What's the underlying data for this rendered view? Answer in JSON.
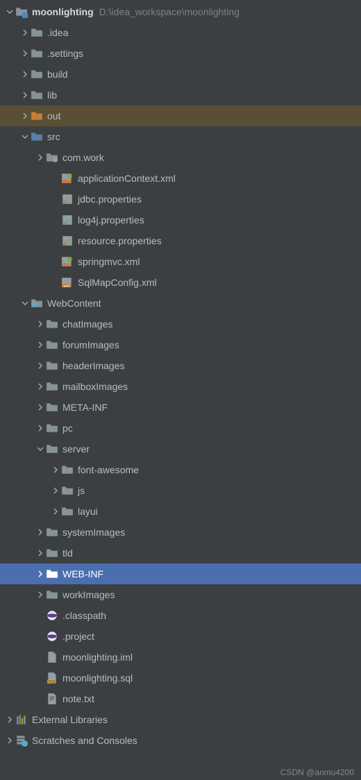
{
  "project": {
    "name": "moonlighting",
    "path": "D:\\idea_workspace\\moonlighting"
  },
  "tree": [
    {
      "id": "root",
      "indent": 0,
      "arrow": "down",
      "icon": "module",
      "label": "moonlighting",
      "bold": true,
      "pathHint": "D:\\idea_workspace\\moonlighting"
    },
    {
      "id": "idea",
      "indent": 1,
      "arrow": "right",
      "icon": "folder",
      "label": ".idea"
    },
    {
      "id": "settings",
      "indent": 1,
      "arrow": "right",
      "icon": "folder",
      "label": ".settings"
    },
    {
      "id": "build",
      "indent": 1,
      "arrow": "right",
      "icon": "folder",
      "label": "build"
    },
    {
      "id": "lib",
      "indent": 1,
      "arrow": "right",
      "icon": "folder",
      "label": "lib"
    },
    {
      "id": "out",
      "indent": 1,
      "arrow": "right",
      "icon": "folder-orange",
      "label": "out",
      "highlight": "out"
    },
    {
      "id": "src",
      "indent": 1,
      "arrow": "down",
      "icon": "folder-src",
      "label": "src"
    },
    {
      "id": "comwork",
      "indent": 2,
      "arrow": "right",
      "icon": "package",
      "label": "com.work"
    },
    {
      "id": "appctx",
      "indent": 3,
      "arrow": "none",
      "icon": "spring",
      "label": "applicationContext.xml"
    },
    {
      "id": "jdbc",
      "indent": 3,
      "arrow": "none",
      "icon": "properties",
      "label": "jdbc.properties"
    },
    {
      "id": "log4j",
      "indent": 3,
      "arrow": "none",
      "icon": "properties",
      "label": "log4j.properties"
    },
    {
      "id": "resource",
      "indent": 3,
      "arrow": "none",
      "icon": "properties",
      "label": "resource.properties"
    },
    {
      "id": "springmvc",
      "indent": 3,
      "arrow": "none",
      "icon": "spring",
      "label": "springmvc.xml"
    },
    {
      "id": "sqlmapconfig",
      "indent": 3,
      "arrow": "none",
      "icon": "xml",
      "label": "SqlMapConfig.xml"
    },
    {
      "id": "webcontent",
      "indent": 1,
      "arrow": "down",
      "icon": "folder-web",
      "label": "WebContent"
    },
    {
      "id": "chatimages",
      "indent": 2,
      "arrow": "right",
      "icon": "folder",
      "label": "chatImages"
    },
    {
      "id": "forumimages",
      "indent": 2,
      "arrow": "right",
      "icon": "folder",
      "label": "forumImages"
    },
    {
      "id": "headerimages",
      "indent": 2,
      "arrow": "right",
      "icon": "folder",
      "label": "headerImages"
    },
    {
      "id": "mailboximages",
      "indent": 2,
      "arrow": "right",
      "icon": "folder",
      "label": "mailboxImages"
    },
    {
      "id": "metainf",
      "indent": 2,
      "arrow": "right",
      "icon": "folder",
      "label": "META-INF"
    },
    {
      "id": "pc",
      "indent": 2,
      "arrow": "right",
      "icon": "folder",
      "label": "pc"
    },
    {
      "id": "server",
      "indent": 2,
      "arrow": "down",
      "icon": "folder",
      "label": "server"
    },
    {
      "id": "fontawesome",
      "indent": 3,
      "arrow": "right",
      "icon": "folder",
      "label": "font-awesome"
    },
    {
      "id": "js",
      "indent": 3,
      "arrow": "right",
      "icon": "folder",
      "label": "js"
    },
    {
      "id": "layui",
      "indent": 3,
      "arrow": "right",
      "icon": "folder",
      "label": "layui"
    },
    {
      "id": "systemimages",
      "indent": 2,
      "arrow": "right",
      "icon": "folder",
      "label": "systemImages"
    },
    {
      "id": "tld",
      "indent": 2,
      "arrow": "right",
      "icon": "folder",
      "label": "tld"
    },
    {
      "id": "webinf",
      "indent": 2,
      "arrow": "right",
      "icon": "folder",
      "label": "WEB-INF",
      "selected": true
    },
    {
      "id": "workimages",
      "indent": 2,
      "arrow": "right",
      "icon": "folder",
      "label": "workImages"
    },
    {
      "id": "classpath",
      "indent": 2,
      "arrow": "none",
      "icon": "eclipse",
      "label": ".classpath"
    },
    {
      "id": "project",
      "indent": 2,
      "arrow": "none",
      "icon": "eclipse",
      "label": ".project"
    },
    {
      "id": "iml",
      "indent": 2,
      "arrow": "none",
      "icon": "file",
      "label": "moonlighting.iml"
    },
    {
      "id": "sql",
      "indent": 2,
      "arrow": "none",
      "icon": "sql",
      "label": "moonlighting.sql"
    },
    {
      "id": "note",
      "indent": 2,
      "arrow": "none",
      "icon": "text",
      "label": "note.txt"
    },
    {
      "id": "extlib",
      "indent": 0,
      "arrow": "right",
      "icon": "libraries",
      "label": "External Libraries"
    },
    {
      "id": "scratches",
      "indent": 0,
      "arrow": "right",
      "icon": "scratches",
      "label": "Scratches and Consoles"
    }
  ],
  "watermark": "CSDN @anmu4200"
}
